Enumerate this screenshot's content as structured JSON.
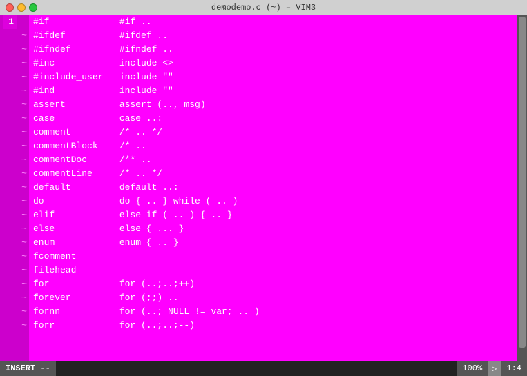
{
  "titlebar": {
    "title": "demodemo.c (~) – VIM3",
    "icon_label": "c"
  },
  "editor": {
    "lines": [
      {
        "num": "1",
        "tilde": " ",
        "code": "#if             #if .."
      },
      {
        "num": "",
        "tilde": "~",
        "code": "#ifdef          #ifdef .."
      },
      {
        "num": "",
        "tilde": "~",
        "code": "#ifndef         #ifndef .."
      },
      {
        "num": "",
        "tilde": "~",
        "code": "#inc            include <>"
      },
      {
        "num": "",
        "tilde": "~",
        "code": "#include_user   include \"\""
      },
      {
        "num": "",
        "tilde": "~",
        "code": "#ind            include \"\""
      },
      {
        "num": "",
        "tilde": "~",
        "code": "assert          assert (.., msg)"
      },
      {
        "num": "",
        "tilde": "~",
        "code": "case            case ..:"
      },
      {
        "num": "",
        "tilde": "~",
        "code": "comment         /* .. */"
      },
      {
        "num": "",
        "tilde": "~",
        "code": "commentBlock    /* .."
      },
      {
        "num": "",
        "tilde": "~",
        "code": "commentDoc      /** .."
      },
      {
        "num": "",
        "tilde": "~",
        "code": "commentLine     /* .. */"
      },
      {
        "num": "",
        "tilde": "~",
        "code": "default         default ..:"
      },
      {
        "num": "",
        "tilde": "~",
        "code": "do              do { .. } while ( .. )"
      },
      {
        "num": "",
        "tilde": "~",
        "code": "elif            else if ( .. ) { .. }"
      },
      {
        "num": "",
        "tilde": "~",
        "code": "else            else { ... }"
      },
      {
        "num": "",
        "tilde": "~",
        "code": "enum            enum { .. }"
      },
      {
        "num": "",
        "tilde": "~",
        "code": "fcomment"
      },
      {
        "num": "",
        "tilde": "~",
        "code": "filehead"
      },
      {
        "num": "",
        "tilde": "~",
        "code": "for             for (..;..;++)"
      },
      {
        "num": "",
        "tilde": "~",
        "code": "forever         for (;;) .."
      },
      {
        "num": "",
        "tilde": "~",
        "code": "fornn           for (..; NULL != var; .. )"
      },
      {
        "num": "",
        "tilde": "~",
        "code": "forr            for (..;..;--)"
      }
    ],
    "cursor_line": 1
  },
  "statusbar": {
    "mode": "INSERT --",
    "percent": "100%",
    "flag": "🚩",
    "position": "1:4"
  }
}
